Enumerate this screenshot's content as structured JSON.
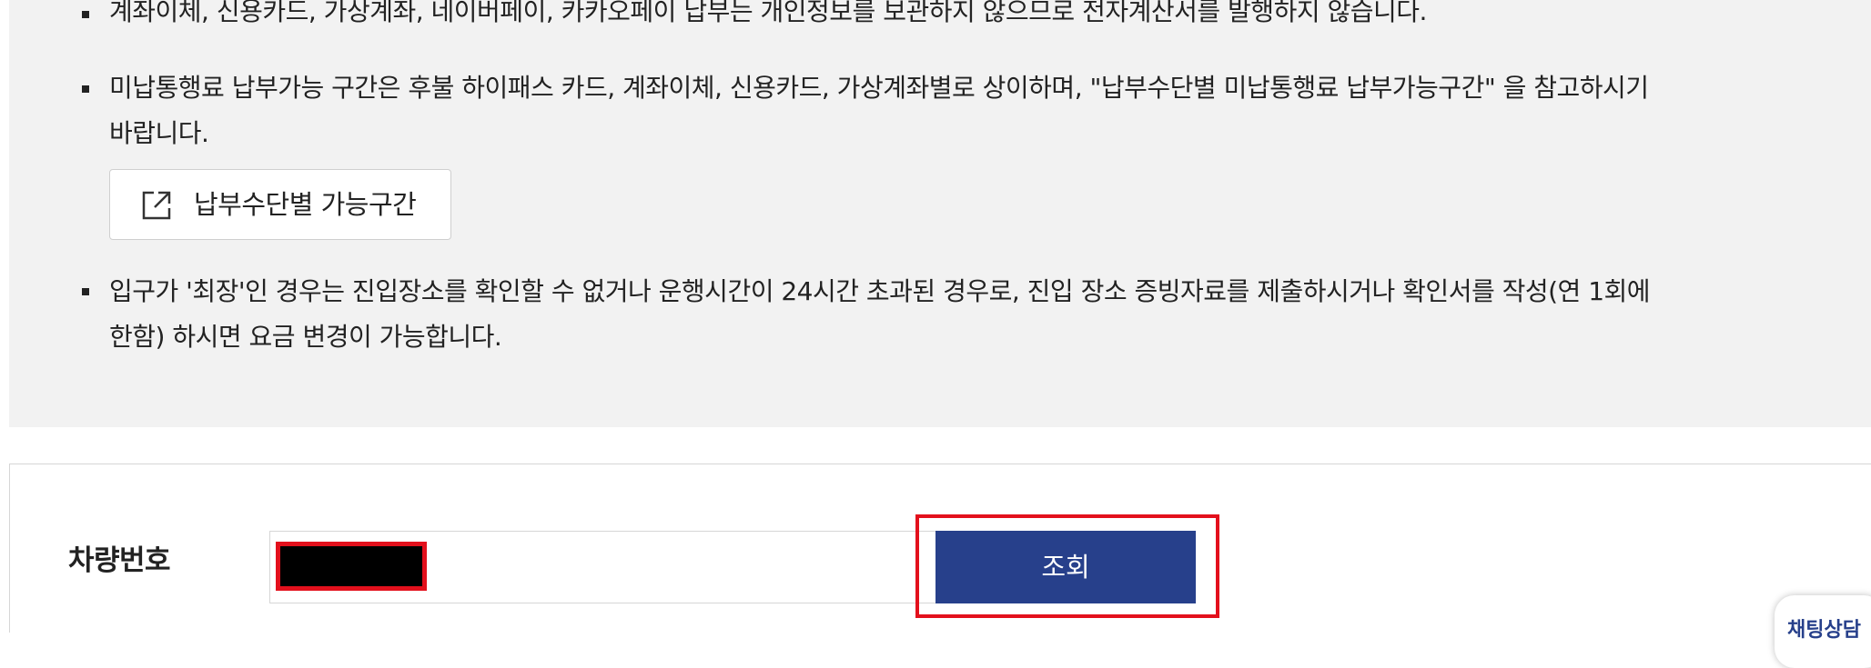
{
  "notices": [
    {
      "lines": [
        "계좌이체, 신용카드, 가상계좌, 네이버페이, 카카오페이 납부는 개인정보를 보관하지 않으므로 전자계산서를 발행하지 않습니다."
      ]
    },
    {
      "lines": [
        "미납통행료 납부가능 구간은 후불 하이패스 카드, 계좌이체, 신용카드, 가상계좌별로 상이하며, \"납부수단별 미납통행료 납부가능구간\" 을 참고하시기",
        "바랍니다."
      ]
    },
    {
      "lines": [
        "입구가 '최장'인 경우는 진입장소를 확인할 수 없거나 운행시간이 24시간 초과된 경우로, 진입 장소 증빙자료를 제출하시거나 확인서를 작성(연 1회에",
        "한함) 하시면 요금 변경이 가능합니다."
      ]
    }
  ],
  "link_button": {
    "label": "납부수단별 가능구간",
    "icon": "external-link-icon"
  },
  "form": {
    "vehicle_number_label": "차량번호",
    "vehicle_number_value": "",
    "search_button_label": "조회"
  },
  "chat_widget": {
    "label": "채팅상담"
  },
  "colors": {
    "notice_background": "#f2f2f2",
    "primary_button": "#27408b",
    "highlight_red": "#e3101c"
  }
}
